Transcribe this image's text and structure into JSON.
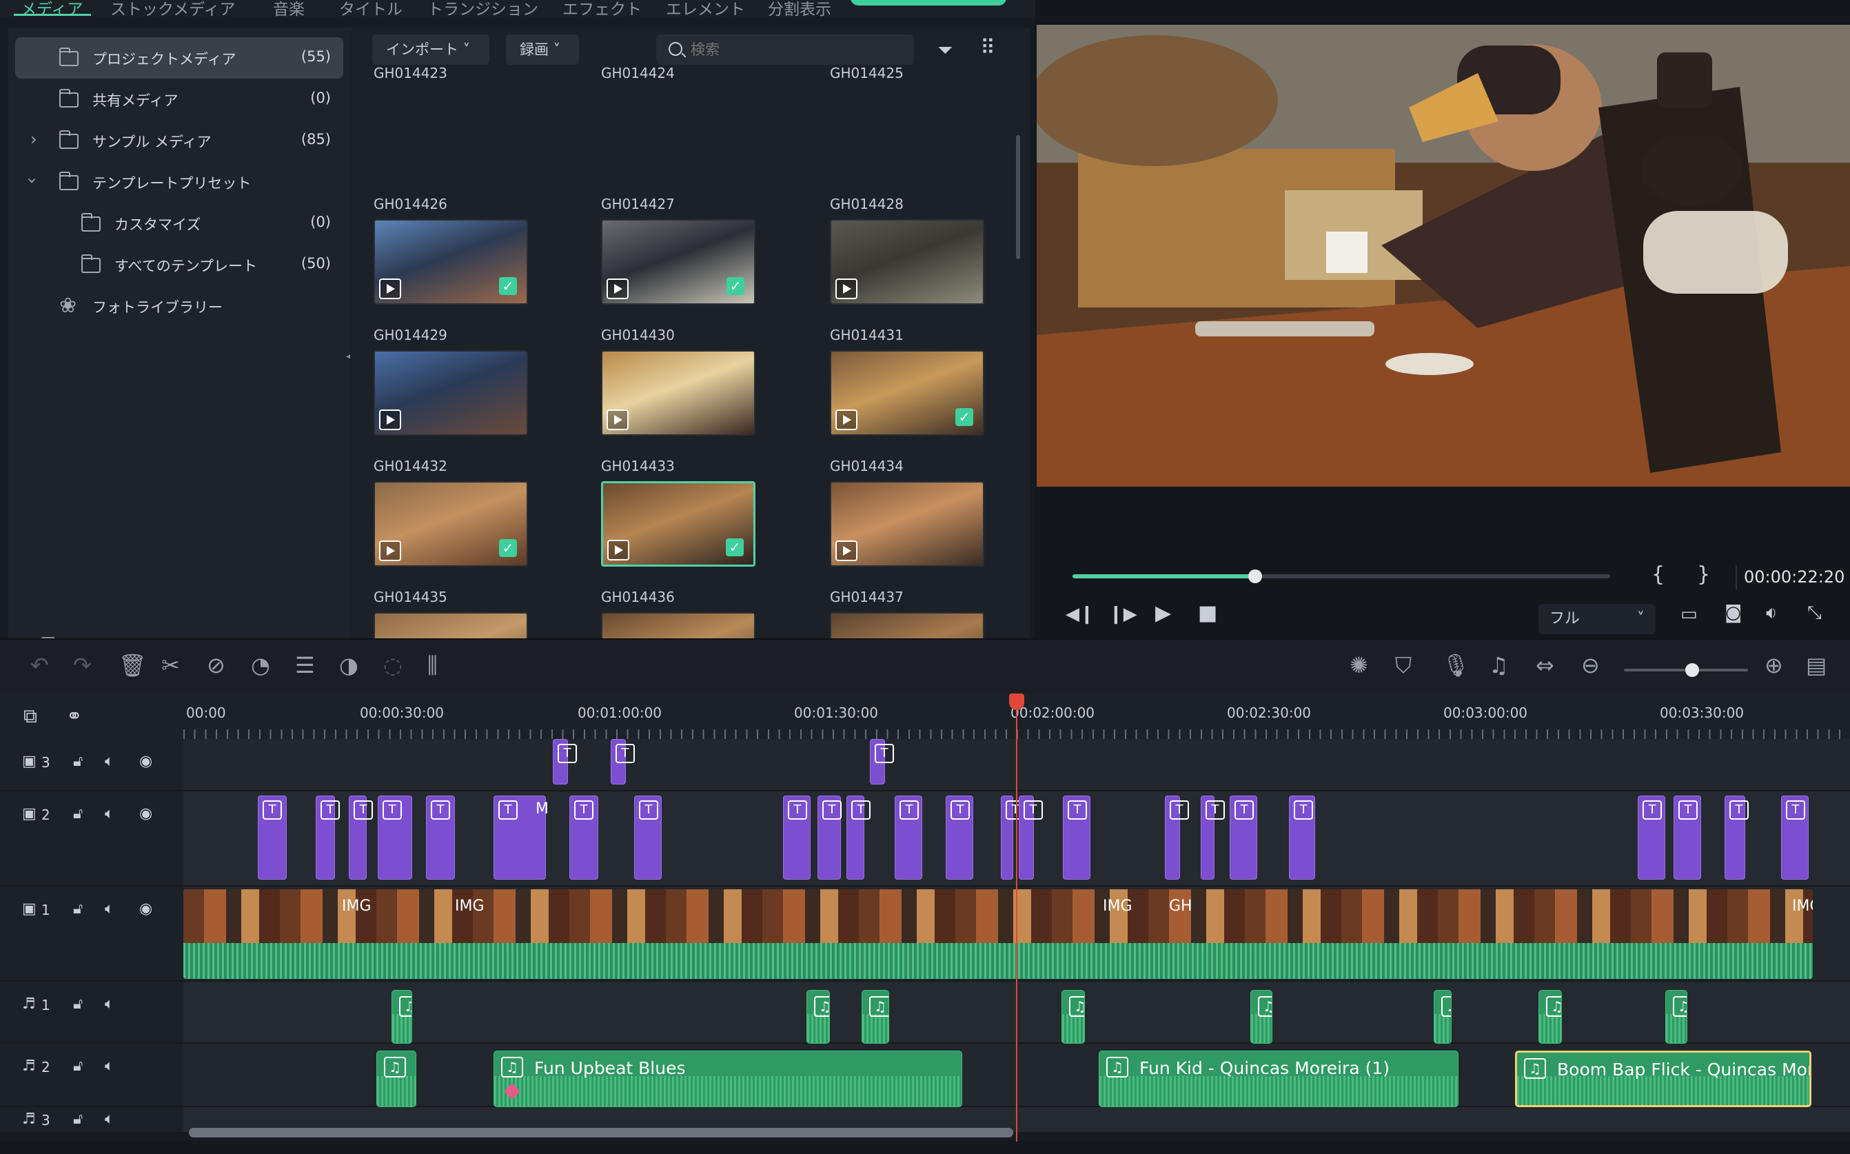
{
  "tabs": [
    "メディア",
    "ストックメディア",
    "音楽",
    "タイトル",
    "トランジション",
    "エフェクト",
    "エレメント",
    "分割表示"
  ],
  "sidebar": {
    "items": [
      {
        "label": "プロジェクトメディア",
        "count": "(55)"
      },
      {
        "label": "共有メディア",
        "count": "(0)"
      },
      {
        "label": "サンプル メディア",
        "count": "(85)"
      },
      {
        "label": "テンプレートプリセット",
        "count": ""
      },
      {
        "label": "カスタマイズ",
        "count": "(0)"
      },
      {
        "label": "すべてのテンプレート",
        "count": "(50)"
      },
      {
        "label": "フォトライブラリー",
        "count": ""
      }
    ]
  },
  "media": {
    "import_label": "インポート",
    "record_label": "録画",
    "search_placeholder": "検索",
    "items": [
      {
        "name": "GH014423"
      },
      {
        "name": "GH014424"
      },
      {
        "name": "GH014425"
      },
      {
        "name": "GH014426",
        "checked": true
      },
      {
        "name": "GH014427",
        "checked": true
      },
      {
        "name": "GH014428"
      },
      {
        "name": "GH014429"
      },
      {
        "name": "GH014430"
      },
      {
        "name": "GH014431",
        "checked": true
      },
      {
        "name": "GH014432",
        "checked": true
      },
      {
        "name": "GH014433",
        "checked": true,
        "selected": true
      },
      {
        "name": "GH014434"
      },
      {
        "name": "GH014435",
        "checked": true
      },
      {
        "name": "GH014436"
      },
      {
        "name": "GH014437",
        "checked": true
      }
    ]
  },
  "preview": {
    "timecode": "00:00:22:20",
    "progress": 0.34,
    "quality": "フル",
    "bracket_in": "{",
    "bracket_out": "}"
  },
  "ruler": {
    "labels": [
      "00:00",
      "00:00:30:00",
      "00:01:00:00",
      "00:01:30:00",
      "00:02:00:00",
      "00:02:30:00",
      "00:03:00:00",
      "00:03:30:00"
    ]
  },
  "tracks": {
    "video": [
      "3",
      "2",
      "1"
    ],
    "audio": [
      "1",
      "2",
      "3"
    ]
  },
  "video_clip_labels": [
    "IMG",
    "IMG",
    "IMG",
    "GH",
    "IMG"
  ],
  "title_text": "T",
  "title_extra": "M",
  "audio_clips": [
    {
      "label": "Fun Upbeat Blues"
    },
    {
      "label": "Fun Kid - Quincas Moreira (1)"
    },
    {
      "label": "Boom Bap Flick - Quincas Mor"
    }
  ],
  "zoom": 0.55
}
